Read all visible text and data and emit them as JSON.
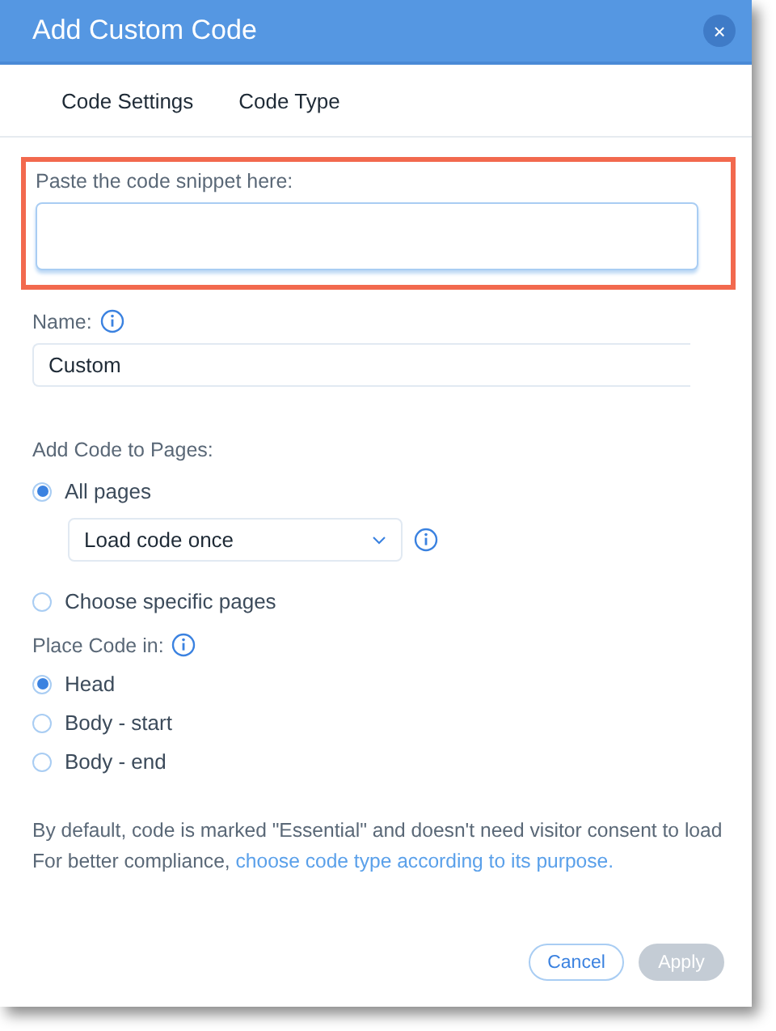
{
  "window": {
    "title": "Add Custom Code",
    "close": "×"
  },
  "tabs": [
    {
      "label": "Code Settings"
    },
    {
      "label": "Code Type"
    }
  ],
  "snippet": {
    "label": "Paste the code snippet here:",
    "highlighted": true
  },
  "name_field": {
    "label": "Name:",
    "value": "Custom"
  },
  "add_to_pages": {
    "label": "Add Code to Pages:",
    "options": [
      {
        "label": "All pages",
        "selected": true,
        "dropdown": "Load code once"
      },
      {
        "label": "Choose specific pages",
        "selected": false
      }
    ]
  },
  "place_code": {
    "label": "Place Code in:",
    "options": [
      {
        "label": "Head",
        "selected": true
      },
      {
        "label": "Body - start",
        "selected": false
      },
      {
        "label": "Body - end",
        "selected": false
      }
    ]
  },
  "note": {
    "line_1": "By default, code is marked \"Essential\" and doesn't need visitor consent to load",
    "line_2": "For better compliance, ",
    "link": "choose code type according to its purpose."
  },
  "buttons": [
    {
      "label": "Cancel",
      "kind": "secondary",
      "disabled": false
    },
    {
      "label": "Apply",
      "kind": "primary",
      "disabled": true
    }
  ]
}
